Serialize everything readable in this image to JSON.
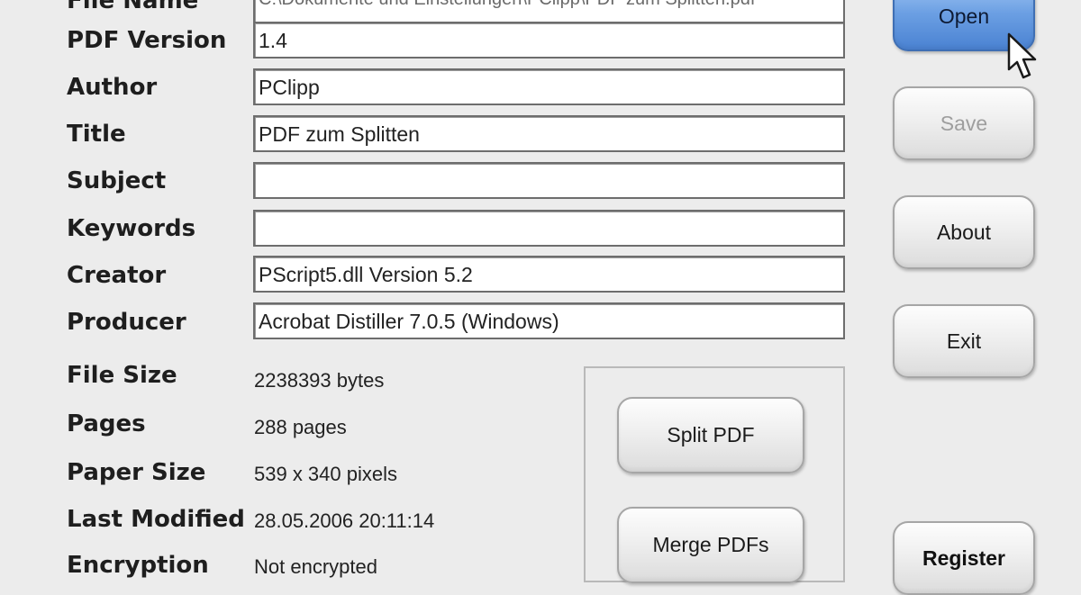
{
  "form": {
    "file_name": {
      "label": "File Name",
      "value": "C:\\Dokumente und Einstellungen\\PClipp\\PDF zum Splitten.pdf"
    },
    "pdf_version": {
      "label": "PDF Version",
      "value": "1.4"
    },
    "author": {
      "label": "Author",
      "value": "PClipp"
    },
    "title": {
      "label": "Title",
      "value": "PDF zum Splitten"
    },
    "subject": {
      "label": "Subject",
      "value": ""
    },
    "keywords": {
      "label": "Keywords",
      "value": ""
    },
    "creator": {
      "label": "Creator",
      "value": "PScript5.dll Version 5.2"
    },
    "producer": {
      "label": "Producer",
      "value": "Acrobat Distiller 7.0.5 (Windows)"
    }
  },
  "info": {
    "file_size": {
      "label": "File Size",
      "value": "2238393 bytes"
    },
    "pages": {
      "label": "Pages",
      "value": "288 pages"
    },
    "paper_size": {
      "label": "Paper Size",
      "value": "539 x 340 pixels"
    },
    "last_modified": {
      "label": "Last Modified",
      "value": "28.05.2006 20:11:14"
    },
    "encryption": {
      "label": "Encryption",
      "value": "Not encrypted"
    }
  },
  "actions": {
    "split": "Split PDF",
    "merge": "Merge PDFs"
  },
  "side_buttons": {
    "open": "Open",
    "save": "Save",
    "about": "About",
    "exit": "Exit",
    "register": "Register"
  },
  "colors": {
    "background": "#ececec",
    "primary_button": "#6b9fe3",
    "disabled_text": "#9e9e9e"
  },
  "icons": [
    "mouse-pointer-icon"
  ]
}
